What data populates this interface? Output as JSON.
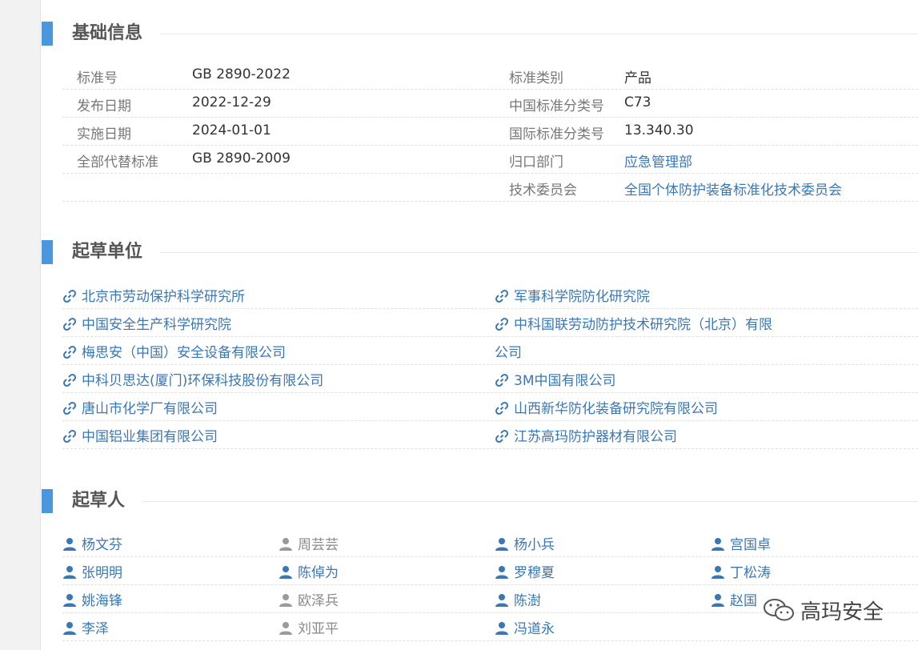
{
  "sections": {
    "basic": "基础信息",
    "drafting_units": "起草单位",
    "drafters": "起草人"
  },
  "basic_info": {
    "left": [
      {
        "key": "标准号",
        "value": "GB 2890-2022"
      },
      {
        "key": "发布日期",
        "value": "2022-12-29"
      },
      {
        "key": "实施日期",
        "value": "2024-01-01"
      },
      {
        "key": "全部代替标准",
        "value": "GB 2890-2009"
      }
    ],
    "right": [
      {
        "key": "标准类别",
        "value": "产品"
      },
      {
        "key": "中国标准分类号",
        "value": "C73"
      },
      {
        "key": "国际标准分类号",
        "value": "13.340.30"
      },
      {
        "key": "归口部门",
        "value": "应急管理部"
      },
      {
        "key": "技术委员会",
        "value": "全国个体防护装备标准化技术委员会"
      }
    ]
  },
  "drafting_units": {
    "left": [
      "北京市劳动保护科学研究所",
      "中国安全生产科学研究院",
      "梅思安（中国）安全设备有限公司",
      "中科贝思达(厦门)环保科技股份有限公司",
      "唐山市化学厂有限公司",
      "中国铝业集团有限公司"
    ],
    "right": [
      "军事科学院防化研究院",
      "中科国联劳动防护技术研究院（北京）有限",
      "公司",
      "3M中国有限公司",
      "山西新华防化装备研究院有限公司",
      "江苏高玛防护器材有限公司"
    ]
  },
  "drafters": [
    [
      "杨文芬",
      "周芸芸",
      "杨小兵",
      "宫国卓"
    ],
    [
      "张明明",
      "陈倬为",
      "罗穆夏",
      "丁松涛"
    ],
    [
      "姚海锋",
      "欧泽兵",
      "陈澍",
      "赵国"
    ],
    [
      "李泽",
      "刘亚平",
      "冯道永",
      ""
    ]
  ],
  "watermark": "高玛安全",
  "colors": {
    "accent": "#4a97dd",
    "link": "#3a77b7",
    "muted": "#888888"
  },
  "icons": {
    "link": "link-icon",
    "person": "person-icon"
  }
}
